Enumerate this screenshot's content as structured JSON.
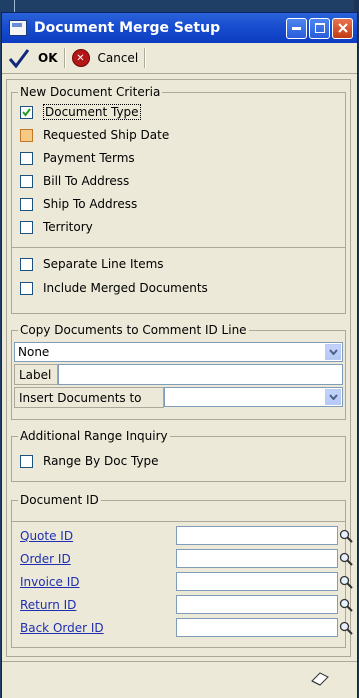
{
  "window": {
    "title": "Document Merge Setup"
  },
  "toolbar": {
    "ok_label": "OK",
    "cancel_label": "Cancel"
  },
  "new_document_criteria": {
    "title": "New Document Criteria",
    "items": [
      {
        "label": "Document Type",
        "checked": true
      },
      {
        "label": "Requested Ship Date",
        "checked": false
      },
      {
        "label": "Payment Terms",
        "checked": false
      },
      {
        "label": "Bill To Address",
        "checked": false
      },
      {
        "label": "Ship To Address",
        "checked": false
      },
      {
        "label": "Territory",
        "checked": false
      }
    ],
    "extra_items": [
      {
        "label": "Separate Line Items",
        "checked": false
      },
      {
        "label": "Include Merged Documents",
        "checked": false
      }
    ]
  },
  "copy_documents": {
    "title": "Copy Documents to Comment ID Line",
    "selected": "None",
    "label_field": "Label",
    "insert_label": "Insert Documents to",
    "insert_value": ""
  },
  "additional_range": {
    "title": "Additional Range Inquiry",
    "range_by_doc_type": "Range By Doc Type"
  },
  "document_id": {
    "title": "Document ID",
    "rows": [
      {
        "label": "Quote ID",
        "value": ""
      },
      {
        "label": "Order ID",
        "value": ""
      },
      {
        "label": "Invoice ID",
        "value": ""
      },
      {
        "label": "Return ID",
        "value": ""
      },
      {
        "label": "Back Order ID",
        "value": ""
      }
    ]
  }
}
